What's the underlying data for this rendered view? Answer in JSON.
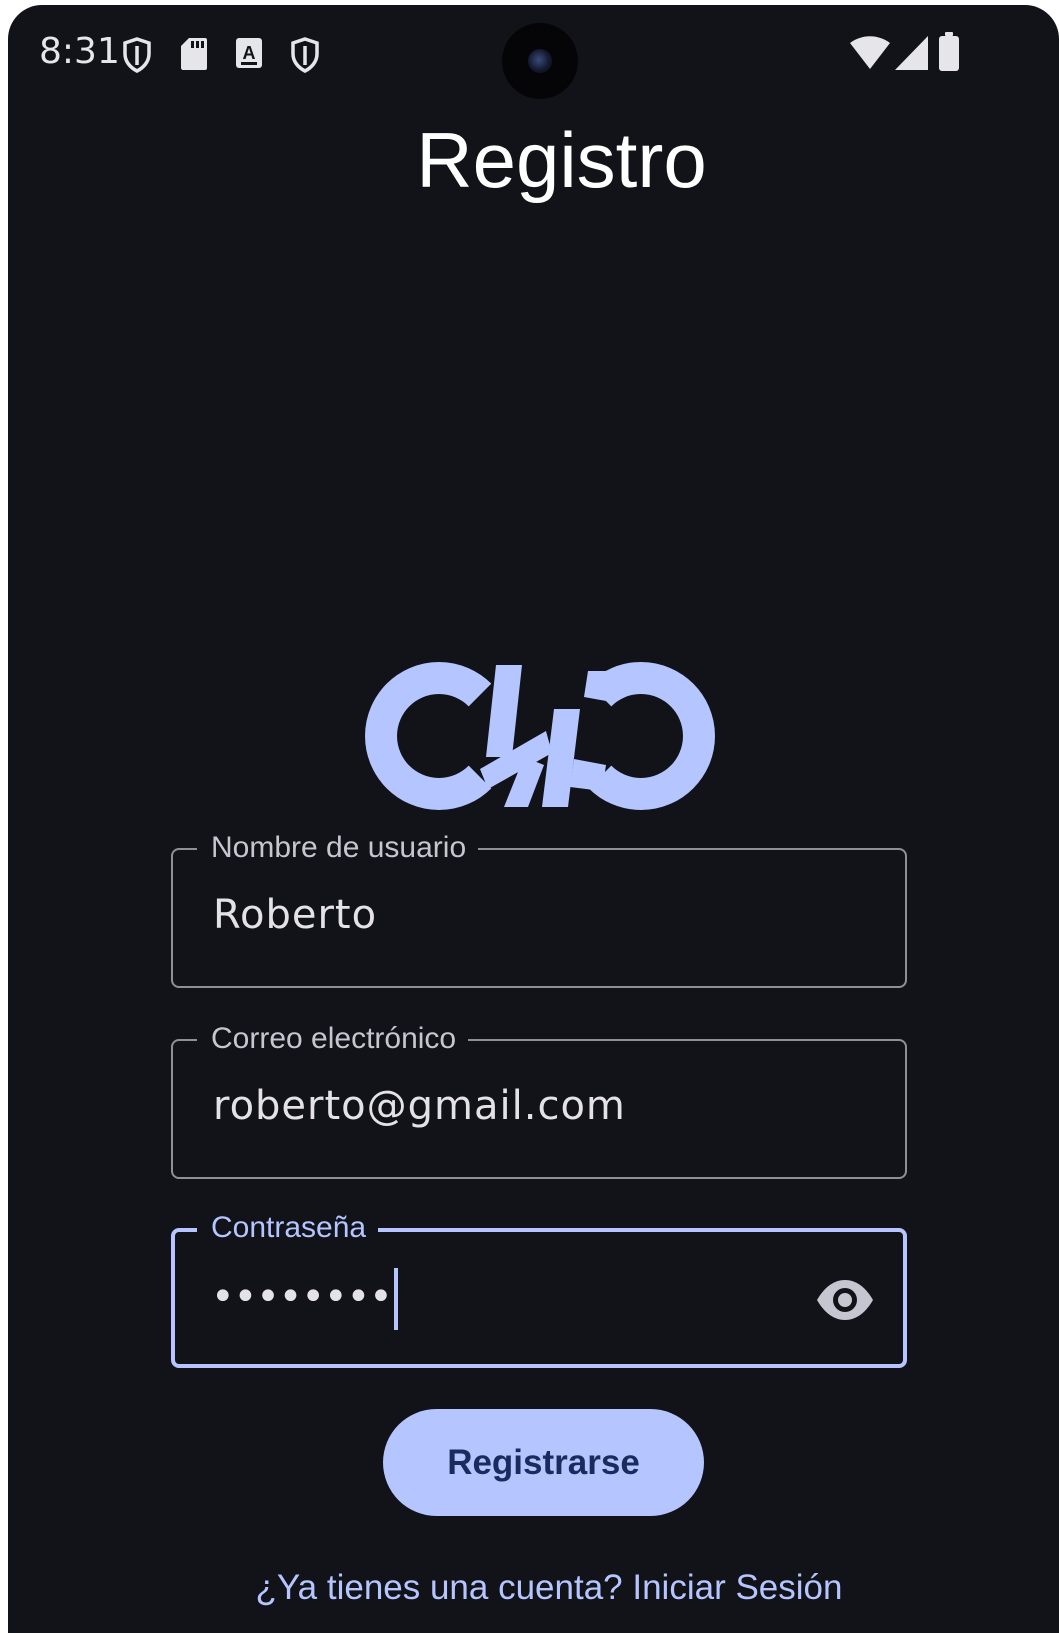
{
  "status_bar": {
    "time": "8:31",
    "left_icons": [
      "shield-icon",
      "sd-card-icon",
      "keyboard-a-icon",
      "shield-icon"
    ],
    "right_icons": [
      "wifi-icon",
      "cell-signal-icon",
      "battery-icon"
    ]
  },
  "screen": {
    "title": "Registro"
  },
  "logo": {
    "text": "CHO",
    "color": "#b4c5ff"
  },
  "form": {
    "username": {
      "label": "Nombre de usuario",
      "value": "Roberto"
    },
    "email": {
      "label": "Correo electrónico",
      "value": "roberto@gmail.com"
    },
    "password": {
      "label": "Contraseña",
      "masked_value": "••••••••",
      "toggle_icon": "eye-icon"
    },
    "submit_label": "Registrarse"
  },
  "footer": {
    "login_prompt": "¿Ya tienes una cuenta? Iniciar Sesión"
  },
  "colors": {
    "background": "#121318",
    "accent": "#b4c5ff",
    "on_accent": "#1a2c5e",
    "outline": "#8e9099",
    "text": "#e4e2e6"
  }
}
